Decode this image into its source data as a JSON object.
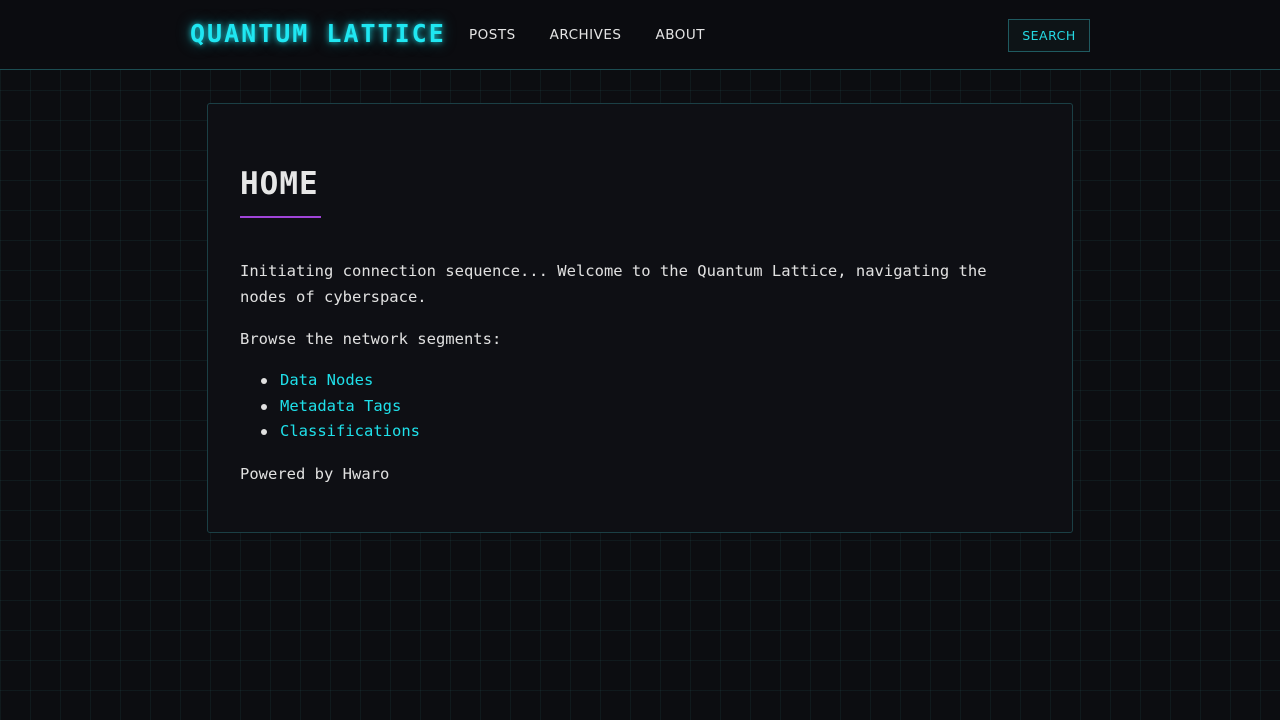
{
  "header": {
    "logo": "QUANTUM LATTICE",
    "nav": [
      {
        "label": "POSTS"
      },
      {
        "label": "ARCHIVES"
      },
      {
        "label": "ABOUT"
      }
    ],
    "search_label": "SEARCH"
  },
  "main": {
    "title": "HOME",
    "intro": "Initiating connection sequence... Welcome to the Quantum Lattice, navigating the nodes of cyberspace.",
    "browse_text": "Browse the network segments:",
    "links": [
      {
        "label": "Data Nodes"
      },
      {
        "label": "Metadata Tags"
      },
      {
        "label": "Classifications"
      }
    ],
    "footer_text": "Powered by Hwaro"
  },
  "colors": {
    "accent": "#1fe7f2",
    "underline": "#a044d8",
    "background": "#0c0d11",
    "card": "#0e0f14"
  }
}
